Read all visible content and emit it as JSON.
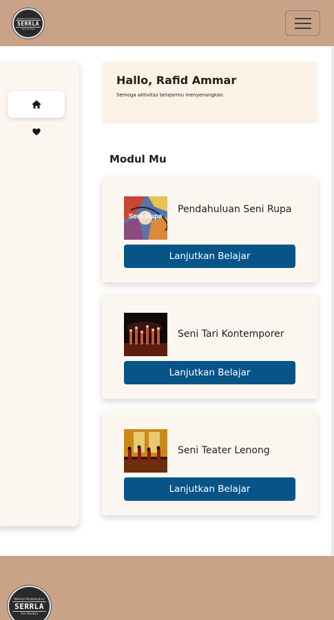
{
  "navbar": {
    "logo": {
      "top_text": "Website Pembelajaran",
      "name": "SERRLA",
      "sub_text": "Seni Budaya"
    },
    "menu_toggle_icon": "hamburger-icon"
  },
  "sidebar": {
    "items": [
      {
        "icon": "home-icon",
        "active": true
      },
      {
        "icon": "heart-icon",
        "active": false
      }
    ]
  },
  "welcome": {
    "greeting": "Hallo, Rafid Ammar",
    "subtitle": "Semoga aktivitas belajarmu menyenangkan."
  },
  "modules": {
    "title": "Modul Mu",
    "items": [
      {
        "title": "Pendahuluan Seni Rupa",
        "thumbnail_caption": "Seni Rupa",
        "button_label": "Lanjutkan Belajar"
      },
      {
        "title": "Seni Tari Kontemporer",
        "button_label": "Lanjutkan Belajar"
      },
      {
        "title": "Seni Teater Lenong",
        "button_label": "Lanjutkan Belajar"
      }
    ]
  },
  "footer": {
    "logo": {
      "top_text": "Website Pembelajaran",
      "name": "SERRLA",
      "sub_text": "Seni Budaya"
    }
  },
  "colors": {
    "navbar": "#c9a287",
    "button": "#075488",
    "card_bg": "#fbf7f0",
    "welcome_bg": "#fcf3e6"
  }
}
